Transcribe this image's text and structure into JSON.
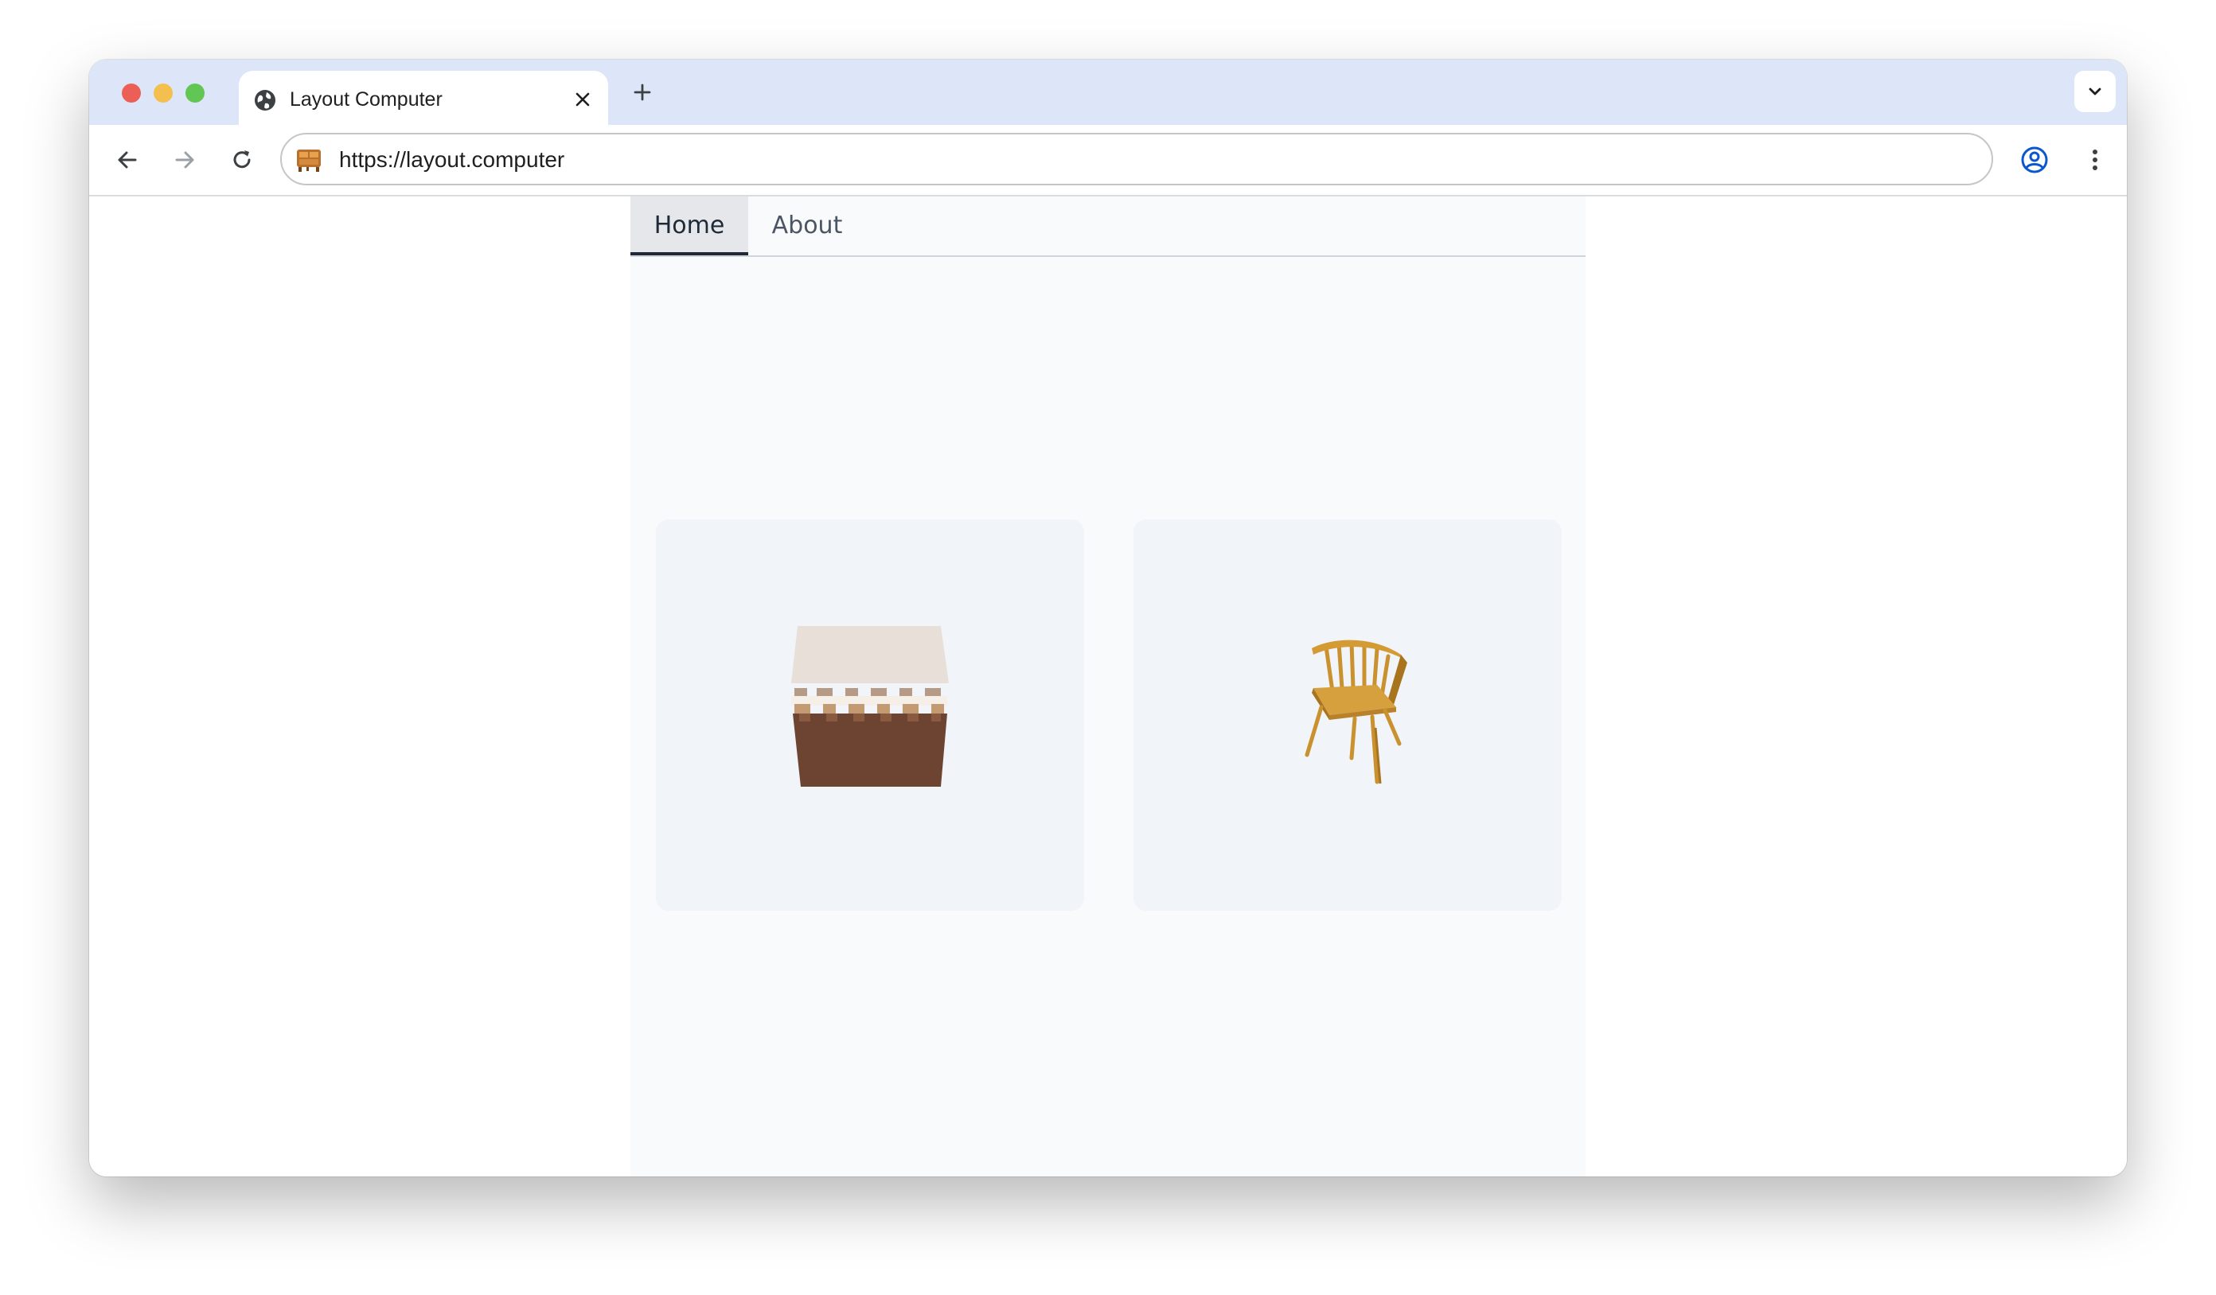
{
  "browser": {
    "tab": {
      "title": "Layout Computer",
      "favicon": "globe-icon",
      "close_icon": "close-icon"
    },
    "new_tab_icon": "plus-icon",
    "tab_search_icon": "chevron-down-icon",
    "toolbar": {
      "back_icon": "arrow-left-icon",
      "forward_icon": "arrow-right-icon",
      "reload_icon": "reload-icon",
      "url": "https://layout.computer",
      "site_icon": "dresser-icon",
      "profile_icon": "profile-icon",
      "menu_icon": "kebab-menu-icon"
    }
  },
  "page": {
    "nav_tabs": [
      {
        "label": "Home",
        "active": true
      },
      {
        "label": "About",
        "active": false
      }
    ],
    "cards": [
      {
        "image": "woven-basket-stool"
      },
      {
        "image": "wooden-windsor-chair"
      }
    ]
  },
  "colors": {
    "tabstrip": "#dce6f8",
    "active_tab_underline": "#1f2937",
    "card_background": "#f1f4f8",
    "page_background": "#f9fafb"
  }
}
